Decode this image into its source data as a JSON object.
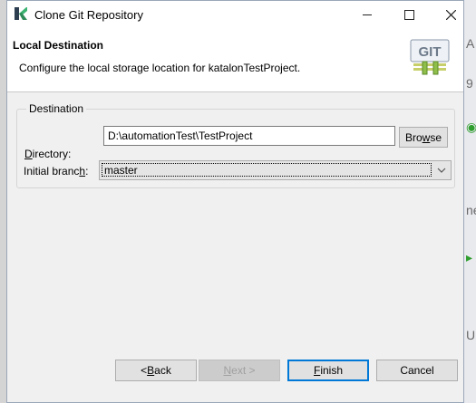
{
  "window": {
    "title": "Clone Git Repository",
    "controls": [
      "minimize",
      "maximize",
      "close"
    ]
  },
  "banner": {
    "title": "Local Destination",
    "description": "Configure the local storage location for katalonTestProject.",
    "icon_label": "GIT",
    "icon": "git-icon"
  },
  "destination": {
    "group_label": "Destination",
    "directory_label_pre": "",
    "directory_label_mnemonic": "D",
    "directory_label_post": "irectory:",
    "directory_value": "D:\\automationTest\\TestProject",
    "browse_pre": "Bro",
    "browse_mnemonic": "w",
    "browse_post": "se",
    "branch_label_pre": "Initial branc",
    "branch_label_mnemonic": "h",
    "branch_label_post": ":",
    "branch_value": "master"
  },
  "footer": {
    "back_pre": "< ",
    "back_mnemonic": "B",
    "back_post": "ack",
    "next_pre": "",
    "next_mnemonic": "N",
    "next_post": "ext >",
    "finish_pre": "",
    "finish_mnemonic": "F",
    "finish_post": "inish",
    "cancel_label": "Cancel"
  },
  "background_fragments": [
    "A",
    "9",
    "ne",
    "U"
  ],
  "colors": {
    "accent": "#0078d7",
    "logo_green": "#3cb371",
    "logo_dark": "#2c3e50"
  }
}
